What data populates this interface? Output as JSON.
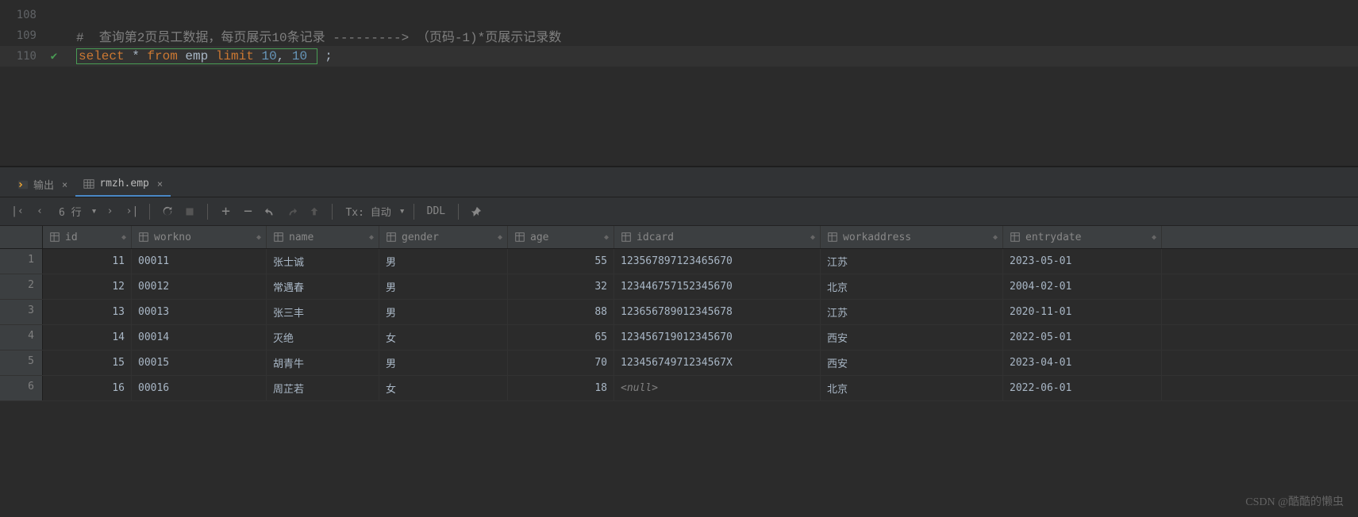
{
  "editor": {
    "lines": [
      {
        "num": "108",
        "check": false,
        "segments": []
      },
      {
        "num": "109",
        "check": false,
        "segments": [
          {
            "cls": "comment",
            "t": "#  查询第2页员工数据，每页展示10条记录 ---------> （页码-1)*页展示记录数"
          }
        ]
      },
      {
        "num": "110",
        "check": true,
        "highlight": true,
        "boxed": true,
        "segments": [
          {
            "cls": "keyword",
            "t": "select"
          },
          {
            "cls": "default",
            "t": " * "
          },
          {
            "cls": "keyword",
            "t": "from"
          },
          {
            "cls": "default",
            "t": " emp "
          },
          {
            "cls": "keyword",
            "t": "limit"
          },
          {
            "cls": "default",
            "t": " "
          },
          {
            "cls": "number",
            "t": "10"
          },
          {
            "cls": "default",
            "t": ", "
          },
          {
            "cls": "number",
            "t": "10"
          },
          {
            "cls": "default",
            "t": " "
          }
        ],
        "tail": " ;"
      }
    ]
  },
  "tabs": {
    "output_label": "输出",
    "result_label": "rmzh.emp"
  },
  "toolbar": {
    "rowcount": "6 行",
    "tx_label": "Tx: 自动",
    "ddl_label": "DDL"
  },
  "columns": [
    {
      "key": "id",
      "label": "id",
      "cls": "col-id",
      "numeric": true
    },
    {
      "key": "workno",
      "label": "workno",
      "cls": "col-workno"
    },
    {
      "key": "name",
      "label": "name",
      "cls": "col-name"
    },
    {
      "key": "gender",
      "label": "gender",
      "cls": "col-gender"
    },
    {
      "key": "age",
      "label": "age",
      "cls": "col-age",
      "numeric": true
    },
    {
      "key": "idcard",
      "label": "idcard",
      "cls": "col-idcard"
    },
    {
      "key": "workaddress",
      "label": "workaddress",
      "cls": "col-workaddr"
    },
    {
      "key": "entrydate",
      "label": "entrydate",
      "cls": "col-entry"
    }
  ],
  "rows": [
    {
      "id": "11",
      "workno": "00011",
      "name": "张士诚",
      "gender": "男",
      "age": "55",
      "idcard": "123567897123465670",
      "workaddress": "江苏",
      "entrydate": "2023-05-01"
    },
    {
      "id": "12",
      "workno": "00012",
      "name": "常遇春",
      "gender": "男",
      "age": "32",
      "idcard": "123446757152345670",
      "workaddress": "北京",
      "entrydate": "2004-02-01"
    },
    {
      "id": "13",
      "workno": "00013",
      "name": "张三丰",
      "gender": "男",
      "age": "88",
      "idcard": "123656789012345678",
      "workaddress": "江苏",
      "entrydate": "2020-11-01"
    },
    {
      "id": "14",
      "workno": "00014",
      "name": "灭绝",
      "gender": "女",
      "age": "65",
      "idcard": "123456719012345670",
      "workaddress": "西安",
      "entrydate": "2022-05-01"
    },
    {
      "id": "15",
      "workno": "00015",
      "name": "胡青牛",
      "gender": "男",
      "age": "70",
      "idcard": "12345674971234567X",
      "workaddress": "西安",
      "entrydate": "2023-04-01"
    },
    {
      "id": "16",
      "workno": "00016",
      "name": "周芷若",
      "gender": "女",
      "age": "18",
      "idcard": null,
      "workaddress": "北京",
      "entrydate": "2022-06-01"
    }
  ],
  "null_text": "<null>",
  "watermark": "CSDN @酷酷的懒虫"
}
